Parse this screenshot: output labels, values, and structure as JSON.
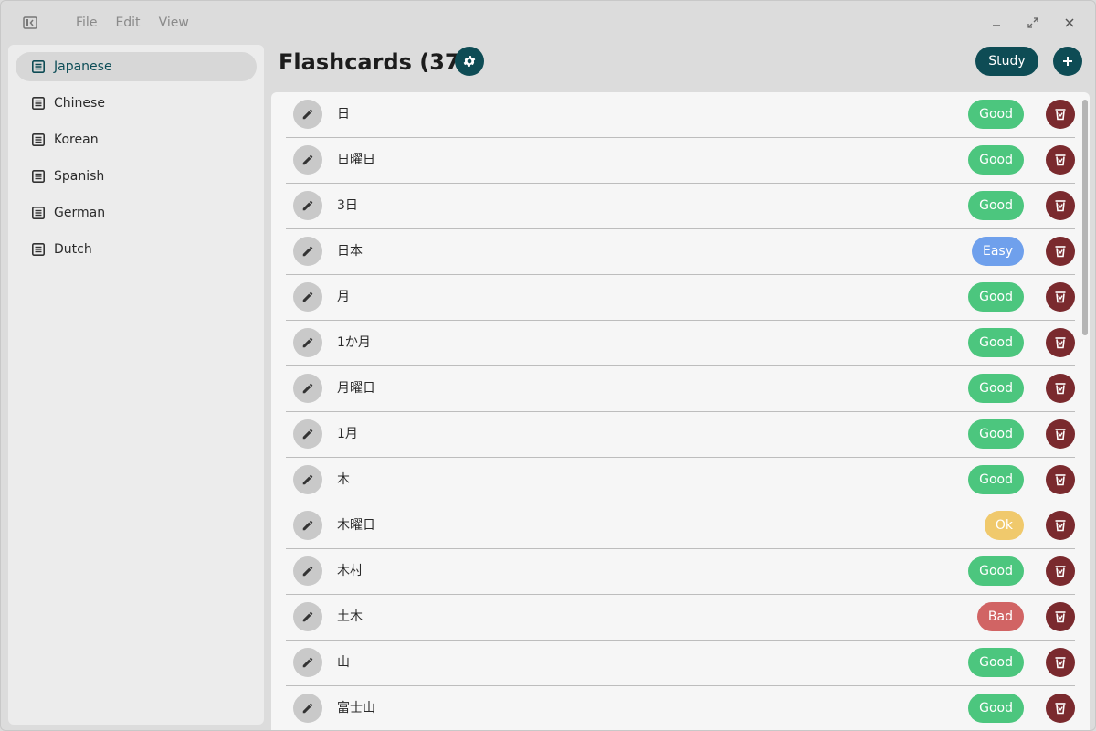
{
  "menu": {
    "file": "File",
    "edit": "Edit",
    "view": "View"
  },
  "sidebar": {
    "items": [
      {
        "label": "Japanese",
        "active": true
      },
      {
        "label": "Chinese",
        "active": false
      },
      {
        "label": "Korean",
        "active": false
      },
      {
        "label": "Spanish",
        "active": false
      },
      {
        "label": "German",
        "active": false
      },
      {
        "label": "Dutch",
        "active": false
      }
    ]
  },
  "header": {
    "title": "Flashcards (37)",
    "study_label": "Study",
    "add_label": "+"
  },
  "colors": {
    "accent": "#0e4c55",
    "good": "#4cc67e",
    "easy": "#6fa0ec",
    "ok": "#f0c96c",
    "bad": "#d16464",
    "delete": "#7a2a2e"
  },
  "cards": [
    {
      "term": "日",
      "rating": "Good"
    },
    {
      "term": "日曜日",
      "rating": "Good"
    },
    {
      "term": "3日",
      "rating": "Good"
    },
    {
      "term": "日本",
      "rating": "Easy"
    },
    {
      "term": "月",
      "rating": "Good"
    },
    {
      "term": "1か月",
      "rating": "Good"
    },
    {
      "term": "月曜日",
      "rating": "Good"
    },
    {
      "term": "1月",
      "rating": "Good"
    },
    {
      "term": "木",
      "rating": "Good"
    },
    {
      "term": "木曜日",
      "rating": "Ok"
    },
    {
      "term": "木村",
      "rating": "Good"
    },
    {
      "term": "土木",
      "rating": "Bad"
    },
    {
      "term": "山",
      "rating": "Good"
    },
    {
      "term": "富士山",
      "rating": "Good"
    }
  ]
}
